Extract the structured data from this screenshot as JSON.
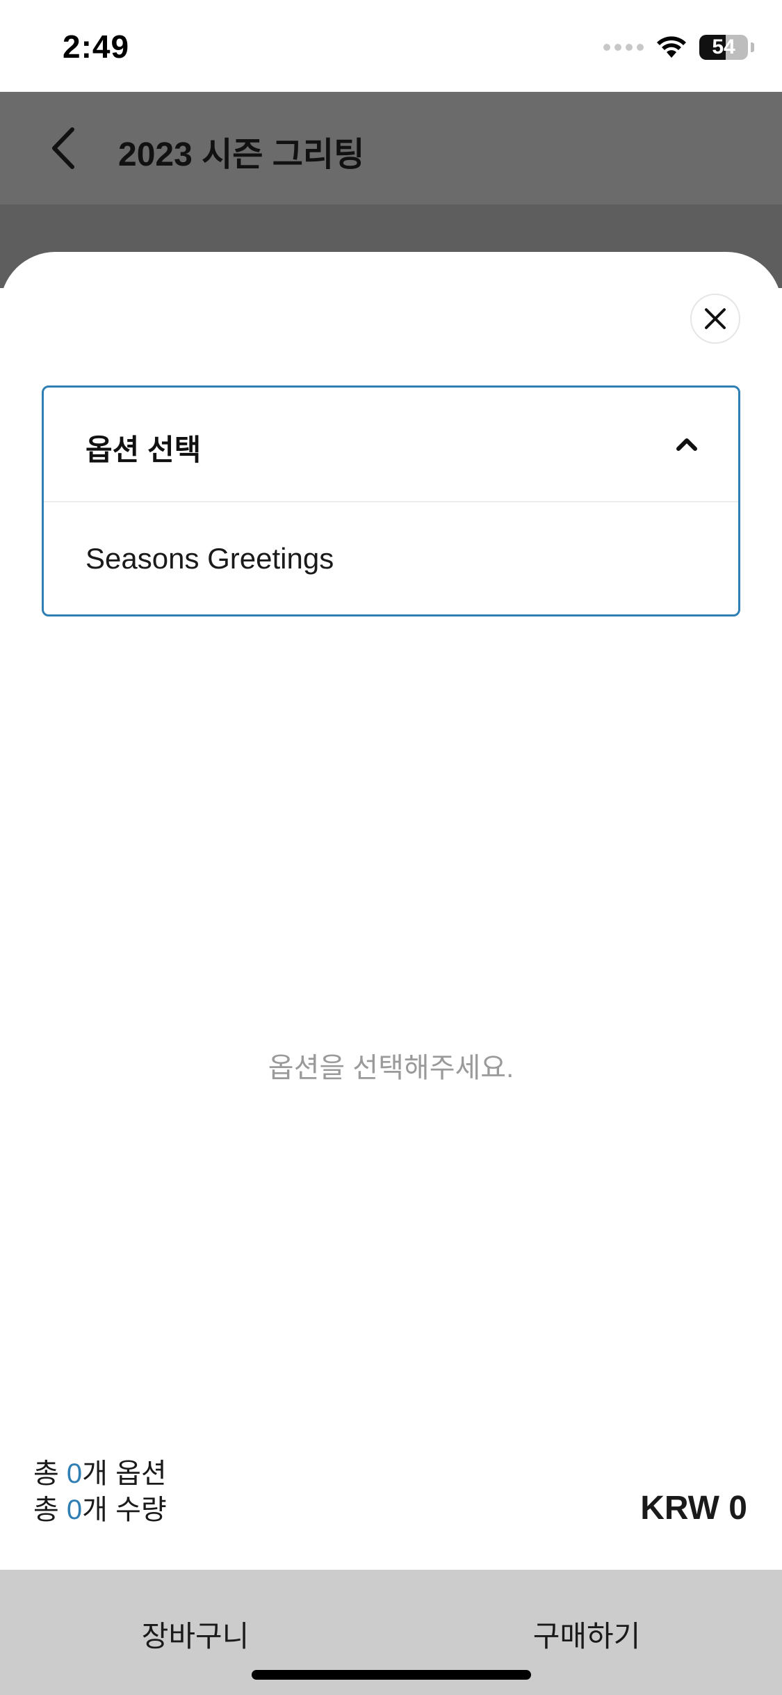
{
  "status_bar": {
    "time": "2:49",
    "battery_level": "54",
    "battery_fraction": 0.54
  },
  "header": {
    "title": "2023 시즌 그리팅",
    "back_icon": "chevron-left-icon"
  },
  "sheet": {
    "close_icon": "close-icon",
    "option_select": {
      "label": "옵션 선택",
      "expanded": true,
      "toggle_icon": "chevron-up-icon",
      "items": [
        "Seasons Greetings"
      ]
    },
    "empty_message": "옵션을 선택해주세요.",
    "summary": {
      "prefix": "총 ",
      "option_count": "0",
      "option_suffix": "개 옵션",
      "quantity_count": "0",
      "quantity_suffix": "개 수량"
    },
    "total_price": "KRW 0"
  },
  "actions": {
    "cart_label": "장바구니",
    "buy_label": "구매하기"
  },
  "colors": {
    "accent": "#2f7fb4",
    "action_bar": "#cccccc",
    "header_dim": "#6b6b6b"
  }
}
